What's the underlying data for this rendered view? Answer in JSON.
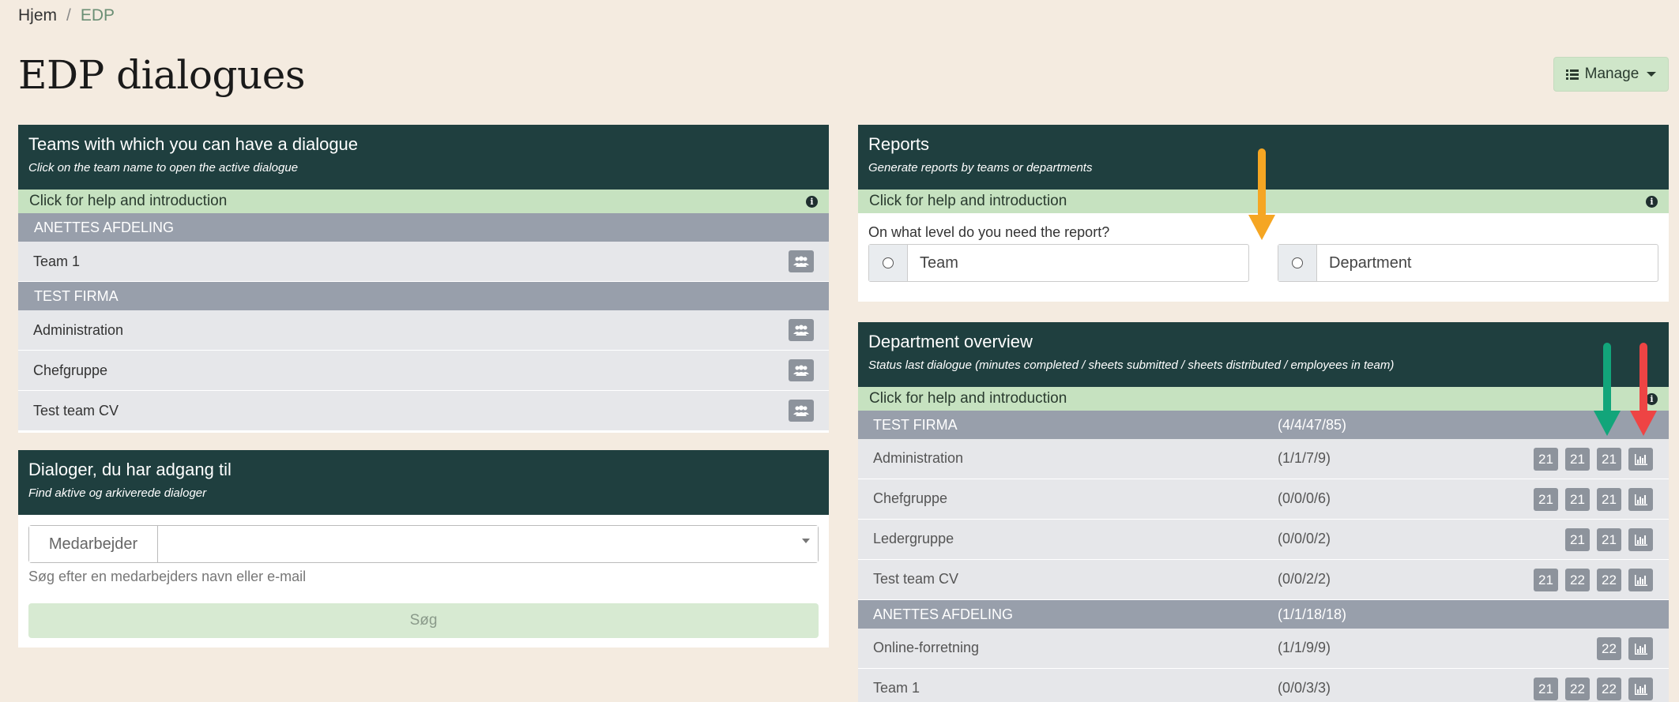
{
  "breadcrumb": {
    "home": "Hjem",
    "separator": "/",
    "current": "EDP"
  },
  "page_title": "EDP dialogues",
  "manage_button": {
    "label": "Manage",
    "icon": "list-icon"
  },
  "teams_card": {
    "title": "Teams with which you can have a dialogue",
    "subtitle": "Click on the team name to open the active dialogue",
    "help": "Click for help and introduction",
    "groups": [
      {
        "name": "ANETTES AFDELING",
        "teams": [
          "Team 1"
        ]
      },
      {
        "name": "TEST FIRMA",
        "teams": [
          "Administration",
          "Chefgruppe",
          "Test team CV"
        ]
      }
    ]
  },
  "dialogs_card": {
    "title": "Dialoger, du har adgang til",
    "subtitle": "Find aktive og arkiverede dialoger",
    "field_prefix": "Medarbejder",
    "hint": "Søg efter en medarbejders navn eller e-mail",
    "search_button": "Søg"
  },
  "reports_card": {
    "title": "Reports",
    "subtitle": "Generate reports by teams or departments",
    "help": "Click for help and introduction",
    "question": "On what level do you need the report?",
    "options": [
      "Team",
      "Department"
    ]
  },
  "overview_card": {
    "title": "Department overview",
    "subtitle": "Status last dialogue (minutes completed / sheets submitted / sheets distributed / employees in team)",
    "help": "Click for help and introduction",
    "groups": [
      {
        "name": "TEST FIRMA",
        "status": "(4/4/47/85)",
        "rows": [
          {
            "name": "Administration",
            "status": "(1/1/7/9)",
            "badges": [
              "21",
              "21",
              "21"
            ]
          },
          {
            "name": "Chefgruppe",
            "status": "(0/0/0/6)",
            "badges": [
              "21",
              "21",
              "21"
            ]
          },
          {
            "name": "Ledergruppe",
            "status": "(0/0/0/2)",
            "badges": [
              "21",
              "21"
            ]
          },
          {
            "name": "Test team CV",
            "status": "(0/0/2/2)",
            "badges": [
              "21",
              "22",
              "22"
            ]
          }
        ]
      },
      {
        "name": "ANETTES AFDELING",
        "status": "(1/1/18/18)",
        "rows": [
          {
            "name": "Online-forretning",
            "status": "(1/1/9/9)",
            "badges": [
              "22"
            ]
          },
          {
            "name": "Team 1",
            "status": "(0/0/3/3)",
            "badges": [
              "21",
              "22",
              "22"
            ]
          }
        ]
      }
    ]
  },
  "colors": {
    "header": "#1f3f3f",
    "help_bar": "#c6e2c0",
    "background": "#f4ebe0",
    "arrow_orange": "#f5a623",
    "arrow_green": "#12a57a",
    "arrow_red": "#ee4444"
  }
}
